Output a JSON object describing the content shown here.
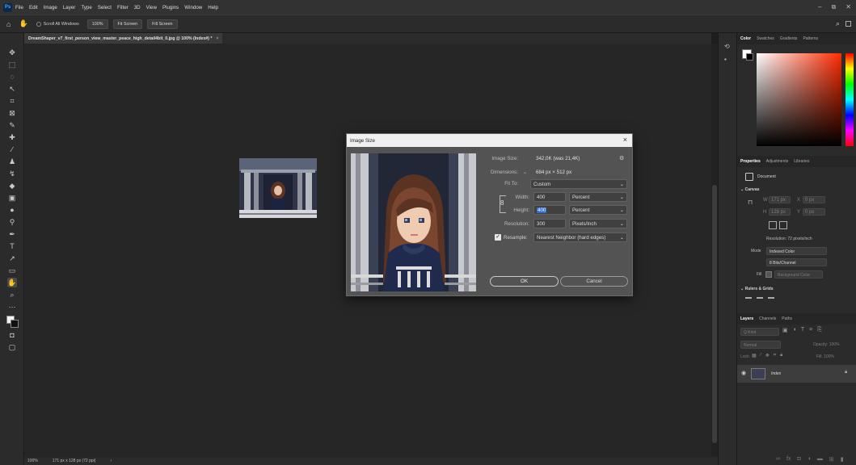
{
  "menubar": {
    "logo": "Ps",
    "items": [
      "File",
      "Edit",
      "Image",
      "Layer",
      "Type",
      "Select",
      "Filter",
      "3D",
      "View",
      "Plugins",
      "Window",
      "Help"
    ]
  },
  "options": {
    "scroll_all": "Scroll All Windows",
    "zoom100": "100%",
    "fit_screen": "Fit Screen",
    "fill_screen": "Fill Screen"
  },
  "document": {
    "tab_title": "DreamShaper_v7_first_person_view_master_peace_high_detail4bit_0.jpg @ 100% (Index#) *"
  },
  "status": {
    "zoom": "100%",
    "size": "171 px x 128 px (72 ppi)"
  },
  "dialog": {
    "title": "Image Size",
    "image_size_label": "Image Size:",
    "image_size_value": "342,0K (was 21,4K)",
    "dimensions_label": "Dimensions:",
    "dimensions_value": "684 px  ×  512 px",
    "fit_to_label": "Fit To:",
    "fit_to_value": "Custom",
    "width_label": "Width:",
    "width_value": "400",
    "width_unit": "Percent",
    "height_label": "Height:",
    "height_value": "400",
    "height_unit": "Percent",
    "resolution_label": "Resolution:",
    "resolution_value": "300",
    "resolution_unit": "Pixels/Inch",
    "resample_label": "Resample:",
    "resample_value": "Nearest Neighbor (hard edges)",
    "ok": "OK",
    "cancel": "Cancel"
  },
  "color_panel": {
    "tabs": [
      "Color",
      "Swatches",
      "Gradients",
      "Patterns"
    ]
  },
  "properties": {
    "tabs": [
      "Properties",
      "Adjustments",
      "Libraries"
    ],
    "doc_label": "Document",
    "canvas": "Canvas",
    "w_label": "W",
    "w_value": "171 px",
    "h_label": "H",
    "h_value": "128 px",
    "x_label": "X",
    "x_value": "0 px",
    "y_label": "Y",
    "y_value": "0 px",
    "resolution_text": "Resolution: 72 pixels/inch",
    "mode_label": "Mode",
    "mode_value": "Indexed Color",
    "bits_value": "8 Bits/Channel",
    "fill_label": "Fill",
    "fill_value": "Background Color",
    "rulers": "Rulers & Grids"
  },
  "layers": {
    "tabs": [
      "Layers",
      "Channels",
      "Paths"
    ],
    "kind": "Q Kind",
    "normal": "Normal",
    "opacity": "Opacity: 100%",
    "lock": "Lock:",
    "fill": "Fill: 100%",
    "layer_name": "Index"
  },
  "colors": {
    "accent": "#4aa3ff",
    "bg": "#1e1e1e",
    "panel": "#2b2b2b"
  }
}
